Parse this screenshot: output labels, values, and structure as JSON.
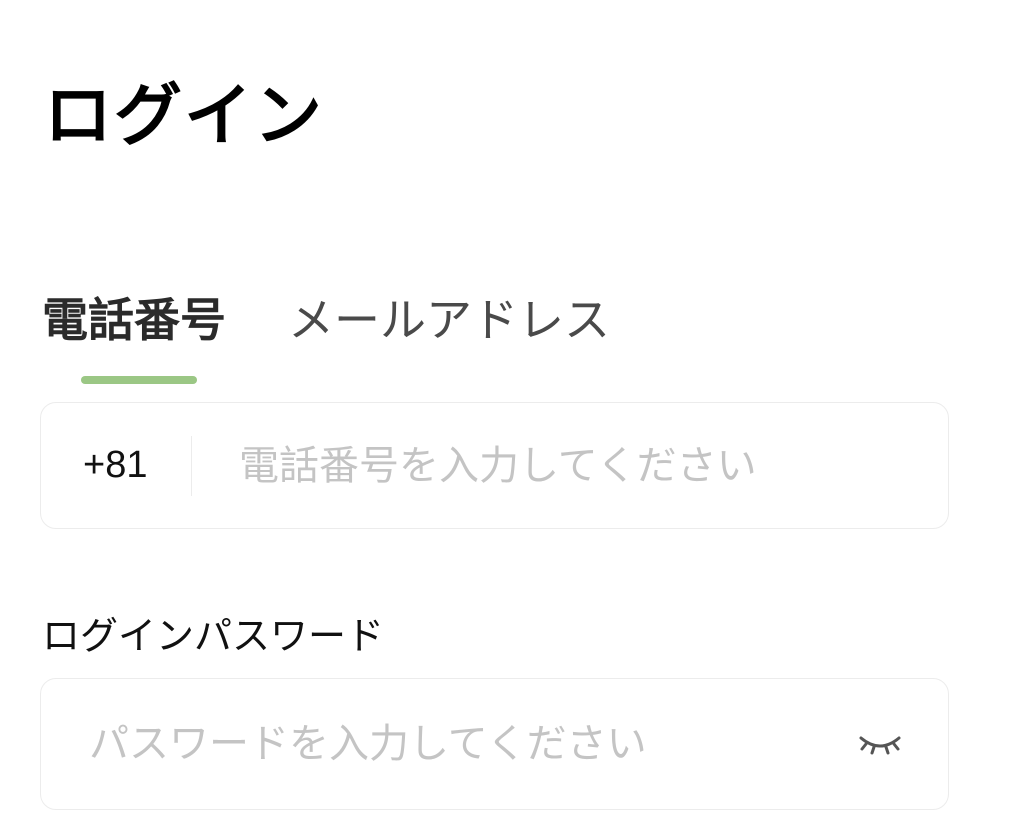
{
  "page": {
    "title": "ログイン"
  },
  "tabs": [
    {
      "label": "電話番号",
      "active": true
    },
    {
      "label": "メールアドレス",
      "active": false
    }
  ],
  "phone_field": {
    "country_code": "+81",
    "value": "",
    "placeholder": "電話番号を入力してください"
  },
  "password_field": {
    "label": "ログインパスワード",
    "value": "",
    "placeholder": "パスワードを入力してください",
    "visibility_icon": "eye-closed-icon"
  },
  "colors": {
    "tab_indicator": "#9bc785",
    "placeholder": "#c4c4c4",
    "field_border": "#ececec"
  }
}
